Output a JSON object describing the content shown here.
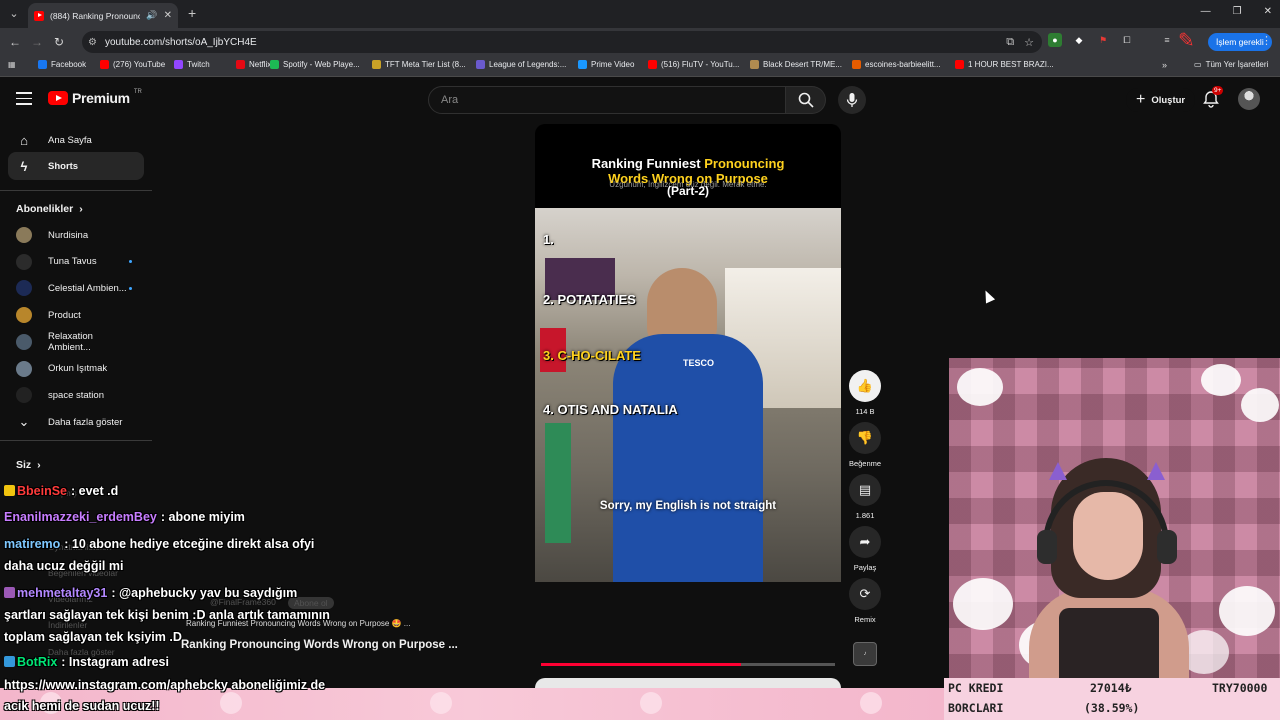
{
  "browser": {
    "tab_title": "(884) Ranking Pronouncing",
    "url": "youtube.com/shorts/oA_IjbYCH4E",
    "update_button": "İşlem gerekli",
    "bookmarks": [
      {
        "label": "Facebook",
        "color": "#1877f2"
      },
      {
        "label": "(276) YouTube",
        "color": "#ff0000"
      },
      {
        "label": "Twitch",
        "color": "#9146ff"
      },
      {
        "label": "Netflix",
        "color": "#e50914"
      },
      {
        "label": "Spotify - Web Playe...",
        "color": "#1db954"
      },
      {
        "label": "TFT Meta Tier List (8...",
        "color": "#c9a227"
      },
      {
        "label": "League of Legends:...",
        "color": "#6a5acd"
      },
      {
        "label": "Prime Video",
        "color": "#1a98ff"
      },
      {
        "label": "(516) FluTV - YouTu...",
        "color": "#ff0000"
      },
      {
        "label": "Black Desert TR/ME...",
        "color": "#b08b50"
      },
      {
        "label": "escoines-barbieelitt...",
        "color": "#e65c00"
      },
      {
        "label": "1 HOUR BEST BRAZI...",
        "color": "#ff0000"
      }
    ],
    "bookmarks_all": "Tüm Yer İşaretleri"
  },
  "header": {
    "logo_text": "Premium",
    "logo_sup": "TR",
    "search_placeholder": "Ara",
    "create_label": "Oluştur",
    "notif_count": "9+"
  },
  "sidebar": {
    "home": "Ana Sayfa",
    "shorts": "Shorts",
    "subs_heading": "Abonelikler",
    "subs": [
      {
        "name": "Nurdisina",
        "color": "#8a7a5a",
        "dot": false
      },
      {
        "name": "Tuna Tavus",
        "color": "#2b2b2b",
        "dot": true
      },
      {
        "name": "Celestial Ambien...",
        "color": "#1c2a55",
        "dot": true
      },
      {
        "name": "Product",
        "color": "#b8862b",
        "dot": false
      },
      {
        "name": "Relaxation Ambient...",
        "color": "#4a5a6a",
        "dot": false
      },
      {
        "name": "Orkun Işıtmak",
        "color": "#6a7a8a",
        "dot": false
      },
      {
        "name": "space station",
        "color": "#222222",
        "dot": false
      }
    ],
    "show_more": "Daha fazla göster",
    "you_heading": "Siz"
  },
  "short": {
    "title_white": "Ranking Funniest",
    "title_yellow_1": "Pronouncing",
    "title_yellow_2": "Words Wrong on Purpose",
    "title_part": "(Part-2)",
    "subtitle": "Üzgünüm, İngilizcem düz değil. Merak etme.",
    "ranks": [
      "1.",
      "2. POTATATIES",
      "3. C-HO-CILATE",
      "4. OTIS AND NATALIA"
    ],
    "store_sign": "TESCO",
    "caption": "Sorry, my English is not straight",
    "progress": 0.68
  },
  "actions": {
    "likes": "114 B",
    "dislike": "Beğenme",
    "comments": "1.861",
    "share": "Paylaş",
    "remix": "Remix"
  },
  "chat": [
    {
      "name": "BbeinSe",
      "text": ": evet .d",
      "color": "#ff3b3b",
      "badge": "#f1c40f"
    },
    {
      "name": "Enanilmazzeki_erdemBey",
      "text": ": abone miyim",
      "color": "#c77dff",
      "badge": ""
    },
    {
      "name": "matiremo",
      "text": ": 10 abone hediye etceğine direkt alsa ofyi",
      "color": "#7ec8ff",
      "badge": ""
    },
    {
      "name": "",
      "text": "daha ucuz değğil mi",
      "color": "#ffffff",
      "badge": ""
    },
    {
      "name": "mehmetaltay31",
      "text": ": @aphebucky yav bu saydığım",
      "color": "#b388ff",
      "badge": "#9b59b6"
    },
    {
      "name": "",
      "text": "şartları sağlayan tek kişi benim :D anla artık tamamının",
      "color": "#ffffff",
      "badge": ""
    },
    {
      "name": "",
      "text": "toplam sağlayan tek kşiyim .D",
      "color": "#ffffff",
      "badge": ""
    },
    {
      "name": "BotRix",
      "text": ": Instagram adresi",
      "color": "#00e676",
      "badge": "#3498db"
    },
    {
      "name": "",
      "text": "https://www.instagram.com/aphebcky aboneliğimiz de",
      "color": "#ffffff",
      "badge": ""
    },
    {
      "name": "",
      "text": "acik hemi de sudan ucuz!!",
      "color": "#ffffff",
      "badge": ""
    }
  ],
  "ghost_video": {
    "channel": "@FinalFrame360",
    "subscribe": "Abone ol",
    "sub": "Ranking Funniest Pronouncing Words Wrong on Purpose 🤩 ...",
    "title": "Ranking Pronouncing Words Wrong on Purpose ..."
  },
  "ghost_sidebar": [
    "Geçmiş",
    "Oynatma listeleri",
    "Beğenilen videolar",
    "Videolarınız",
    "İndirilenler",
    "Daha fazla göster"
  ],
  "credit": {
    "label1": "PC KREDI",
    "label2": "BORCLARI",
    "amount": "27014₺",
    "percent": "(38.59%)",
    "goal": "TRY70000"
  }
}
